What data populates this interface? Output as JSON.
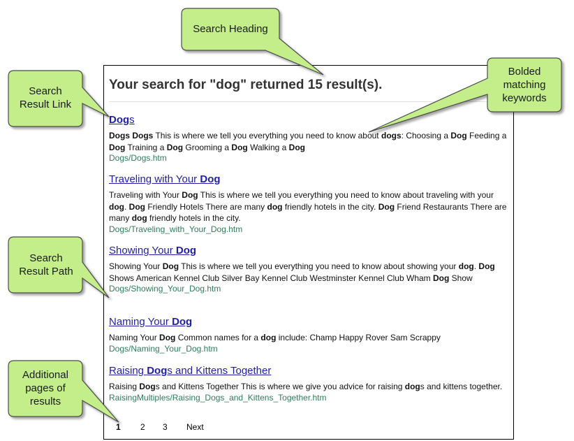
{
  "search": {
    "heading": "Your search for \"dog\" returned 15 result(s)."
  },
  "results": [
    {
      "title_parts": [
        {
          "text": "Dog",
          "bold": true
        },
        {
          "text": "s",
          "bold": false
        }
      ],
      "snippet_parts": [
        {
          "text": "Dogs Dogs",
          "bold": true
        },
        {
          "text": " This is where we tell you everything you need to know about ",
          "bold": false
        },
        {
          "text": "dogs",
          "bold": true
        },
        {
          "text": ": Choosing a ",
          "bold": false
        },
        {
          "text": "Dog",
          "bold": true
        },
        {
          "text": " Feeding a ",
          "bold": false
        },
        {
          "text": "Dog",
          "bold": true
        },
        {
          "text": " Training a ",
          "bold": false
        },
        {
          "text": "Dog",
          "bold": true
        },
        {
          "text": " Grooming a ",
          "bold": false
        },
        {
          "text": "Dog",
          "bold": true
        },
        {
          "text": " Walking a ",
          "bold": false
        },
        {
          "text": "Dog",
          "bold": true
        }
      ],
      "path": "Dogs/Dogs.htm"
    },
    {
      "title_parts": [
        {
          "text": "Traveling with Your ",
          "bold": false
        },
        {
          "text": "Dog",
          "bold": true
        }
      ],
      "snippet_parts": [
        {
          "text": "Traveling with Your ",
          "bold": false
        },
        {
          "text": "Dog",
          "bold": true
        },
        {
          "text": " This is where we tell you everything you need to know about traveling with your ",
          "bold": false
        },
        {
          "text": "dog",
          "bold": true
        },
        {
          "text": ". ",
          "bold": false
        },
        {
          "text": "Dog",
          "bold": true
        },
        {
          "text": " Friendly Hotels There are many ",
          "bold": false
        },
        {
          "text": "dog",
          "bold": true
        },
        {
          "text": " friendly hotels in the city. ",
          "bold": false
        },
        {
          "text": "Dog",
          "bold": true
        },
        {
          "text": " Friend Restaurants There are many ",
          "bold": false
        },
        {
          "text": "dog",
          "bold": true
        },
        {
          "text": " friendly hotels in the city.",
          "bold": false
        }
      ],
      "path": "Dogs/Traveling_with_Your_Dog.htm"
    },
    {
      "title_parts": [
        {
          "text": "Showing Your ",
          "bold": false
        },
        {
          "text": "Dog",
          "bold": true
        }
      ],
      "snippet_parts": [
        {
          "text": "Showing Your ",
          "bold": false
        },
        {
          "text": "Dog",
          "bold": true
        },
        {
          "text": " This is where we tell you everything you need to know about showing your ",
          "bold": false
        },
        {
          "text": "dog",
          "bold": true
        },
        {
          "text": ". ",
          "bold": false
        },
        {
          "text": "Dog",
          "bold": true
        },
        {
          "text": " Shows American Kennel Club Silver Bay Kennel Club Westminster Kennel Club Wham ",
          "bold": false
        },
        {
          "text": "Dog",
          "bold": true
        },
        {
          "text": " Show",
          "bold": false
        }
      ],
      "path": "Dogs/Showing_Your_Dog.htm"
    },
    {
      "title_parts": [
        {
          "text": "Naming Your ",
          "bold": false
        },
        {
          "text": "Dog",
          "bold": true
        }
      ],
      "snippet_parts": [
        {
          "text": "Naming Your ",
          "bold": false
        },
        {
          "text": "Dog",
          "bold": true
        },
        {
          "text": " Common names for a ",
          "bold": false
        },
        {
          "text": "dog",
          "bold": true
        },
        {
          "text": " include: Champ Happy Rover Sam Scrappy",
          "bold": false
        }
      ],
      "path": "Dogs/Naming_Your_Dog.htm"
    },
    {
      "title_parts": [
        {
          "text": "Raising ",
          "bold": false
        },
        {
          "text": "Dog",
          "bold": true
        },
        {
          "text": "s and Kittens Together",
          "bold": false
        }
      ],
      "snippet_parts": [
        {
          "text": "Raising ",
          "bold": false
        },
        {
          "text": "Dog",
          "bold": true
        },
        {
          "text": "s and Kittens Together This is where we give you advice for raising ",
          "bold": false
        },
        {
          "text": "dog",
          "bold": true
        },
        {
          "text": "s and kittens together.",
          "bold": false
        }
      ],
      "path": "RaisingMultiples/Raising_Dogs_and_Kittens_Together.htm"
    }
  ],
  "pagination": {
    "current": "1",
    "pages": [
      "2",
      "3"
    ],
    "next": "Next"
  },
  "callouts": {
    "search_heading": "Search Heading",
    "result_link": "Search Result Link",
    "bolded_keywords": "Bolded matching keywords",
    "result_path": "Search Result Path",
    "additional_pages": "Additional pages of results"
  },
  "colors": {
    "callout_fill": "#c4ee8a",
    "link": "#1f1fa6",
    "path": "#2e7d5b"
  }
}
